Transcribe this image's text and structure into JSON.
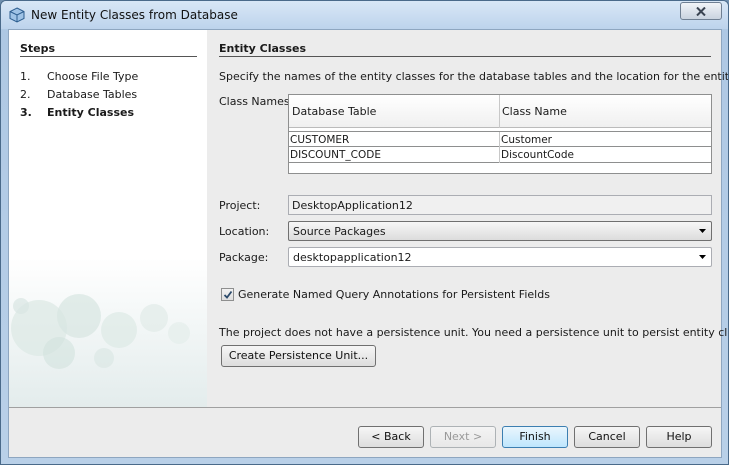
{
  "window": {
    "title": "New Entity Classes from Database"
  },
  "steps": {
    "title": "Steps",
    "items": [
      {
        "num": "1.",
        "label": "Choose File Type"
      },
      {
        "num": "2.",
        "label": "Database Tables"
      },
      {
        "num": "3.",
        "label": "Entity Classes"
      }
    ]
  },
  "content": {
    "title": "Entity Classes",
    "description": "Specify the names of the entity classes for the database tables and the location for the entity classes.",
    "class_names_label": "Class Names:",
    "table": {
      "headers": [
        "Database Table",
        "Class Name"
      ],
      "rows": [
        {
          "table": "CUSTOMER",
          "class": "Customer"
        },
        {
          "table": "DISCOUNT_CODE",
          "class": "DiscountCode"
        }
      ]
    },
    "project_label": "Project:",
    "project_value": "DesktopApplication12",
    "location_label": "Location:",
    "location_value": "Source Packages",
    "package_label": "Package:",
    "package_value": "desktopapplication12",
    "generate_query_label": "Generate Named Query Annotations for Persistent Fields",
    "generate_query_checked": true,
    "persistence_note": "The project does not have a persistence unit. You need a persistence unit to persist entity classes.",
    "create_pu_label": "Create Persistence Unit..."
  },
  "buttons": {
    "back": "< Back",
    "next": "Next >",
    "finish": "Finish",
    "cancel": "Cancel",
    "help": "Help"
  }
}
